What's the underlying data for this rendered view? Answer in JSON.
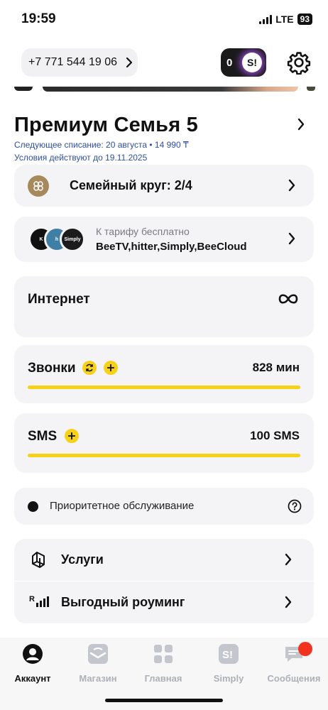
{
  "status": {
    "time": "19:59",
    "network": "LTE",
    "battery": "93"
  },
  "header": {
    "phone": "+7 771 544 19 06",
    "bonus_count": "0",
    "bonus_logo": "S!"
  },
  "plan": {
    "title": "Премиум Семья 5",
    "next_charge": "Следующее списание: 20 августа • 14 990 ₸",
    "conditions": "Условия действуют до 19.11.2025"
  },
  "family": {
    "label": "Семейный круг: 2/4",
    "icon": "family-circle-icon"
  },
  "subscriptions": {
    "caption": "К тарифу бесплатно",
    "list": "BeeTV,hitter,Simply,BeeCloud",
    "logos": [
      "K",
      "h",
      "Simply"
    ]
  },
  "internet": {
    "label": "Интернет",
    "value_icon": "infinity-icon"
  },
  "calls": {
    "label": "Звонки",
    "value": "828 мин",
    "remaining_fraction": 1.0
  },
  "sms": {
    "label": "SMS",
    "value": "100 SMS",
    "remaining_fraction": 1.0
  },
  "priority": {
    "label": "Приоритетное обслуживание"
  },
  "menu": [
    {
      "label": "Услуги",
      "icon": "services-icon"
    },
    {
      "label": "Выгодный роуминг",
      "icon": "roaming-icon"
    }
  ],
  "tabs": [
    {
      "label": "Аккаунт",
      "icon": "account-icon",
      "active": true
    },
    {
      "label": "Магазин",
      "icon": "shop-icon",
      "active": false
    },
    {
      "label": "Главная",
      "icon": "home-grid-icon",
      "active": false
    },
    {
      "label": "Simply",
      "icon": "simply-icon",
      "active": false
    },
    {
      "label": "Сообщения",
      "icon": "messages-icon",
      "active": false
    }
  ],
  "colors": {
    "accent_yellow": "#f7d117",
    "link_blue": "#2d4fa3",
    "card_bg": "#f4f4f6",
    "badge_red": "#f0321e"
  }
}
